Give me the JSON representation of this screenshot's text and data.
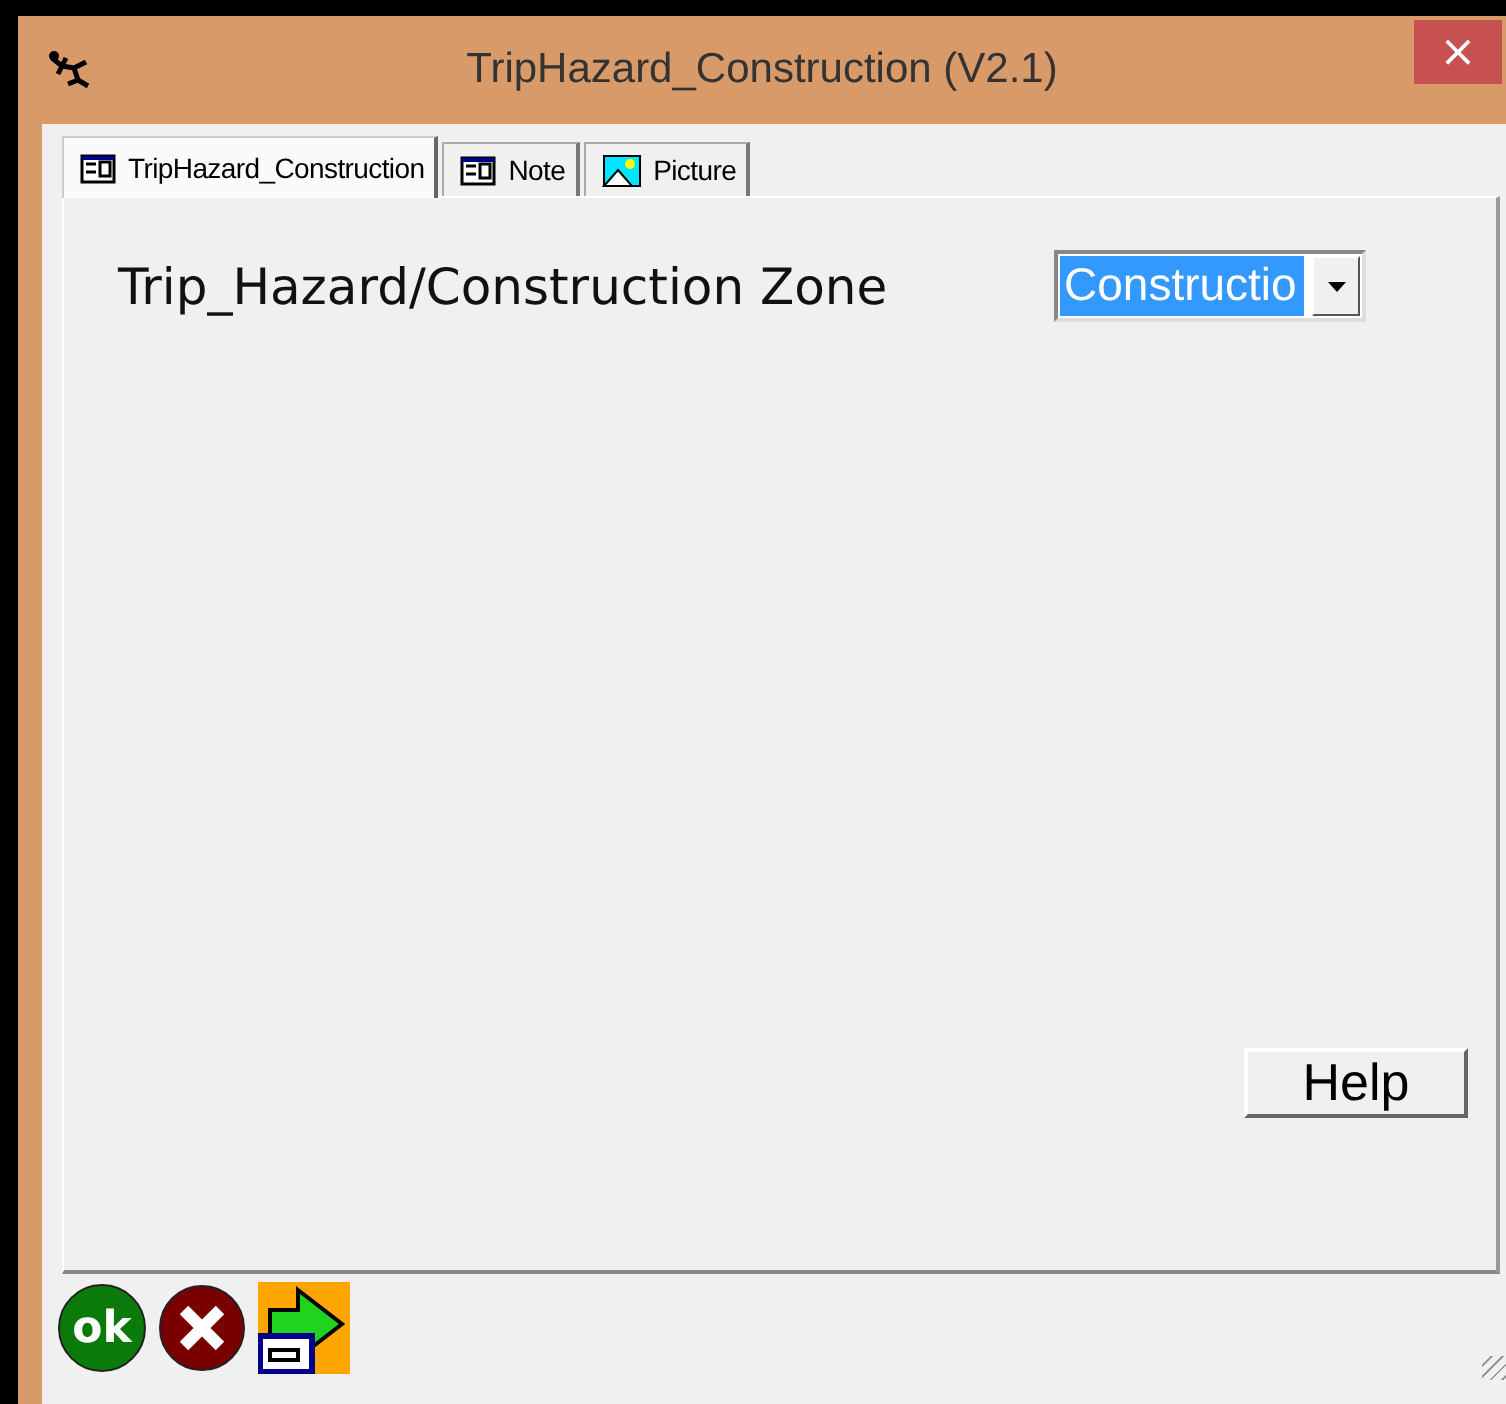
{
  "window": {
    "title": "TripHazard_Construction (V2.1)",
    "close": "×"
  },
  "tabs": [
    {
      "label": "TripHazard_Construction",
      "kind": "form",
      "selected": true
    },
    {
      "label": "Note",
      "kind": "form",
      "selected": false
    },
    {
      "label": "Picture",
      "kind": "image",
      "selected": false
    }
  ],
  "field": {
    "label": "Trip_Hazard/Construction Zone",
    "value": "Constructio"
  },
  "help_button": "Help",
  "footer": {
    "ok": "ok"
  }
}
